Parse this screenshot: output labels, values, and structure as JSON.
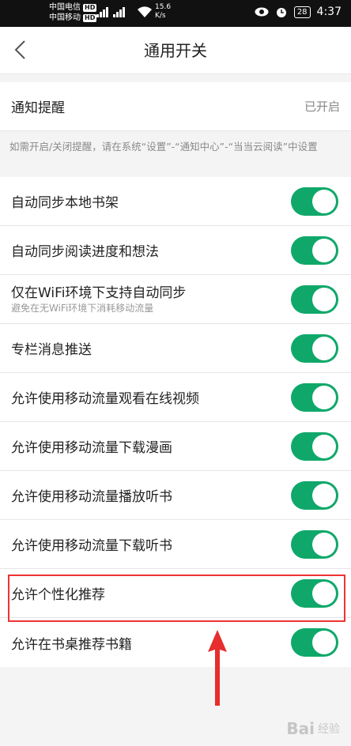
{
  "status_bar": {
    "carrier1": "中国电信",
    "carrier2": "中国移动",
    "hd": "HD",
    "speed": "15.6",
    "speed_unit": "K/s",
    "battery": "28",
    "time": "4:37"
  },
  "nav": {
    "title": "通用开关"
  },
  "notify": {
    "label": "通知提醒",
    "value": "已开启"
  },
  "note": "如需开启/关闭提醒，请在系统“设置”-“通知中心”-“当当云阅读”中设置",
  "settings": [
    {
      "label": "自动同步本地书架",
      "sub": "",
      "on": true
    },
    {
      "label": "自动同步阅读进度和想法",
      "sub": "",
      "on": true
    },
    {
      "label": "仅在WiFi环境下支持自动同步",
      "sub": "避免在无WiFi环境下消耗移动流量",
      "on": true
    },
    {
      "label": "专栏消息推送",
      "sub": "",
      "on": true
    },
    {
      "label": "允许使用移动流量观看在线视频",
      "sub": "",
      "on": true
    },
    {
      "label": "允许使用移动流量下载漫画",
      "sub": "",
      "on": true
    },
    {
      "label": "允许使用移动流量播放听书",
      "sub": "",
      "on": true
    },
    {
      "label": "允许使用移动流量下载听书",
      "sub": "",
      "on": true
    },
    {
      "label": "允许个性化推荐",
      "sub": "",
      "on": true
    },
    {
      "label": "允许在书桌推荐书籍",
      "sub": "",
      "on": true
    }
  ],
  "colors": {
    "toggle_on": "#0fa86a",
    "highlight": "#ee3333"
  },
  "watermark": {
    "text": "Bai",
    "text2": "经验"
  }
}
